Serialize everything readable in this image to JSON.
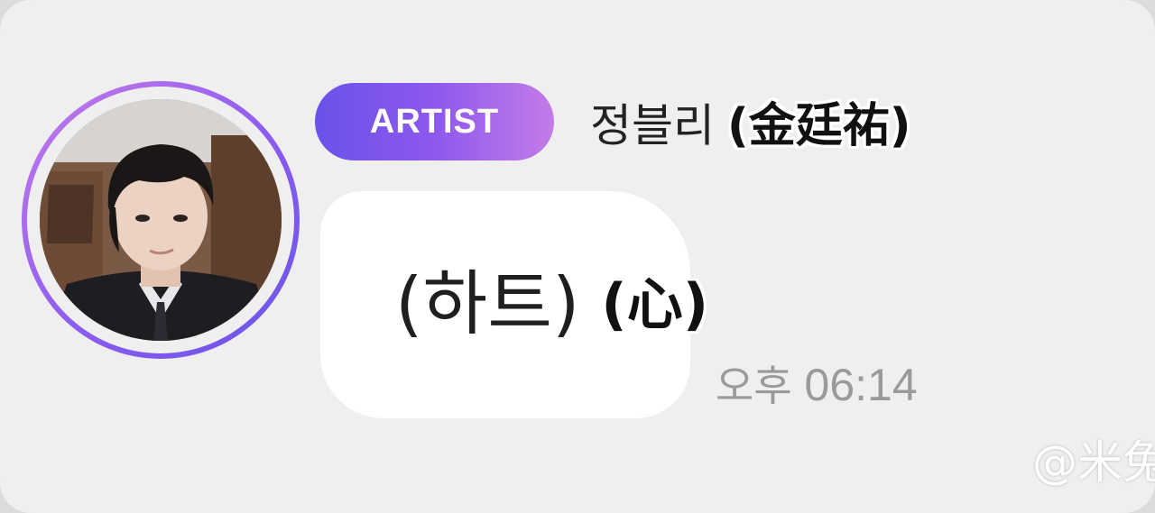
{
  "message": {
    "sender": {
      "badge": "ARTIST",
      "name": "정블리",
      "name_caption": "(金廷祐)",
      "avatar": "profile-photo"
    },
    "text": "(하트)",
    "text_caption": "(心)",
    "time_period": "오후",
    "time": "06:14"
  },
  "watermark": "@米兔",
  "colors": {
    "background": "#efeff0",
    "bubble": "#ffffff",
    "badge_start": "#6a52ea",
    "badge_end": "#c37ce8",
    "timestamp": "#9a9a9c"
  }
}
